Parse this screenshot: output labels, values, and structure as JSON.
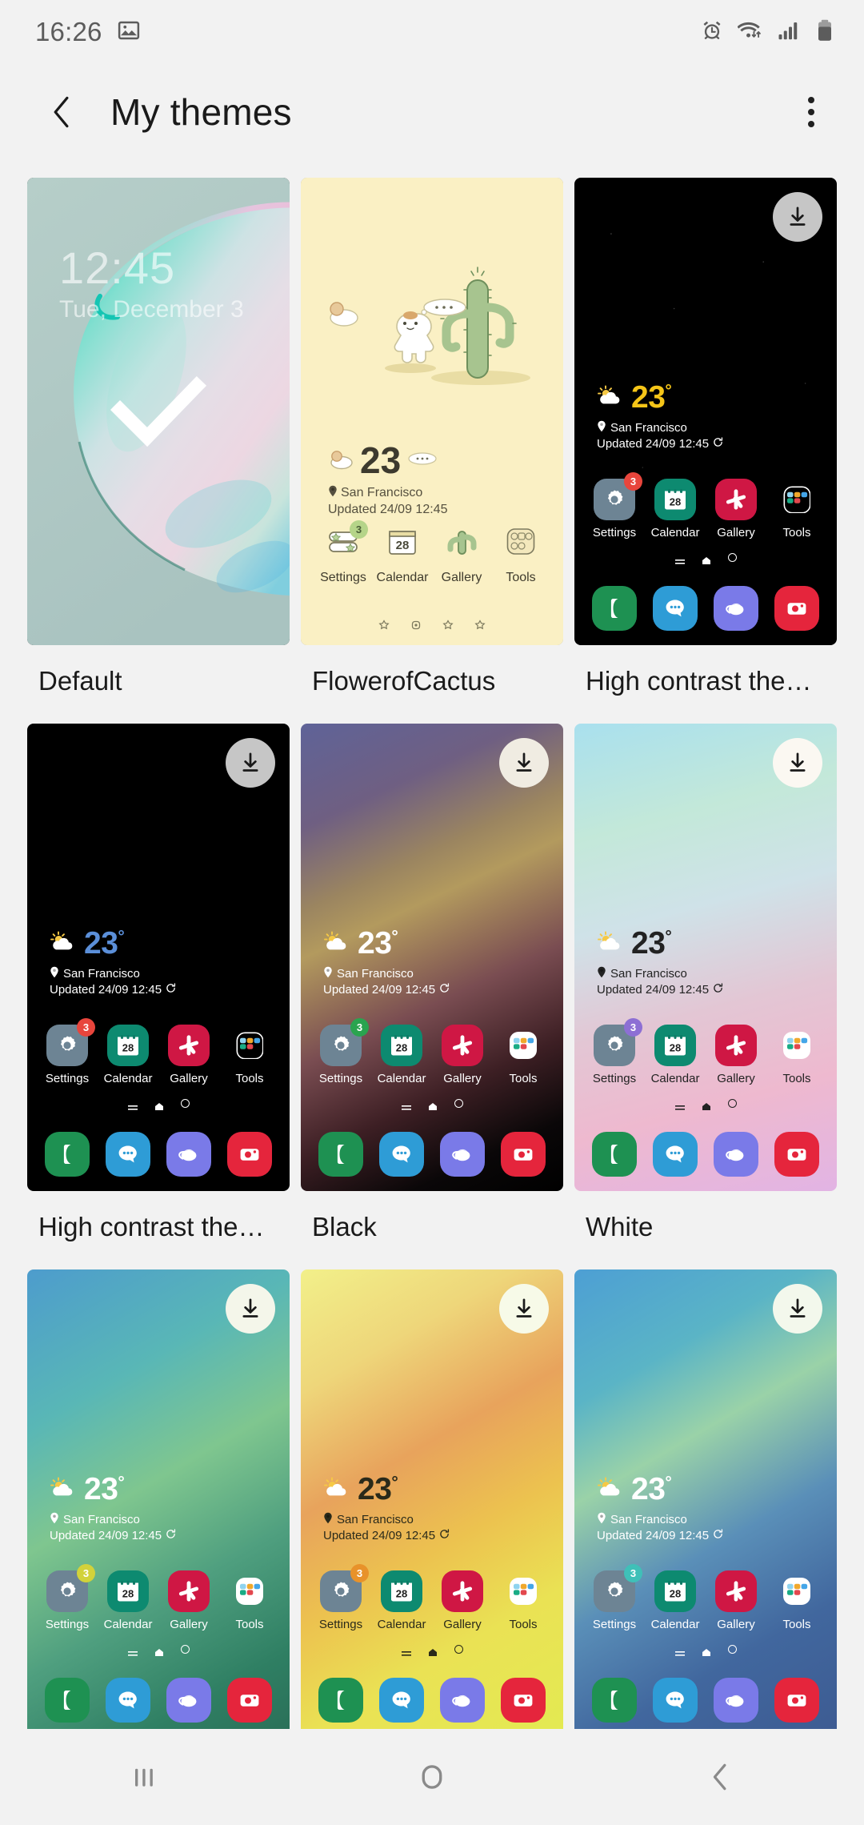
{
  "statusbar": {
    "time": "16:26",
    "icons": [
      "image-icon",
      "alarm-icon",
      "wifi-icon",
      "signal-icon",
      "battery-icon"
    ]
  },
  "appbar": {
    "back_icon": "back-chevron-icon",
    "title": "My themes",
    "menu_icon": "overflow-menu-icon"
  },
  "widget": {
    "temp": "23",
    "degree": "°",
    "location": "San Francisco",
    "updated": "Updated 24/09 12:45",
    "weather_icon": "sun-cloud-icon",
    "location_icon": "location-pin-icon",
    "refresh_icon": "refresh-icon"
  },
  "apps": [
    {
      "label": "Settings",
      "icon": "gear-icon",
      "badge": "3"
    },
    {
      "label": "Calendar",
      "icon": "calendar-icon",
      "day": "28"
    },
    {
      "label": "Gallery",
      "icon": "flower-icon"
    },
    {
      "label": "Tools",
      "icon": "folder-icon"
    }
  ],
  "dock": [
    {
      "icon": "phone-icon"
    },
    {
      "icon": "messages-icon"
    },
    {
      "icon": "internet-icon"
    },
    {
      "icon": "camera-icon"
    }
  ],
  "lockscreen": {
    "clock": "12:45",
    "date": "Tue, December 3"
  },
  "cactus": {
    "temp": "23",
    "location": "San Francisco",
    "updated": "Updated 24/09 12:45",
    "apps": [
      "Settings",
      "Calendar",
      "Gallery",
      "Tools"
    ],
    "badge": "3",
    "day": "28"
  },
  "themes": [
    {
      "label": "Default",
      "kind": "lockscreen",
      "selected": true,
      "downloadable": false
    },
    {
      "label": "FlowerofCactus",
      "kind": "cactus",
      "selected": false,
      "downloadable": false
    },
    {
      "label": "High contrast the…",
      "kind": "home",
      "selected": false,
      "downloadable": true,
      "bg": "black-stars",
      "temp_color": "#f5c518",
      "text_color": "#ffffff",
      "badge_color": "#e8453c",
      "dl_bg": "#c6c6c6",
      "dl_fg": "#1a1a1a",
      "folder_bg": "transparent",
      "folder_border": "#ffffff"
    },
    {
      "label": "High contrast the…",
      "kind": "home",
      "selected": false,
      "downloadable": true,
      "bg": "black-plain",
      "temp_color": "#5b8fd9",
      "text_color": "#ffffff",
      "badge_color": "#e8453c",
      "dl_bg": "#c6c6c6",
      "dl_fg": "#1a1a1a",
      "folder_bg": "transparent",
      "folder_border": "#ffffff"
    },
    {
      "label": "Black",
      "kind": "home",
      "selected": false,
      "downloadable": true,
      "bg": "black-gradient",
      "temp_color": "#ffffff",
      "text_color": "#ffffff",
      "badge_color": "#2aa44f",
      "dl_bg": "#f0ece2",
      "dl_fg": "#1a1a1a",
      "folder_bg": "#ffffff",
      "folder_border": "transparent"
    },
    {
      "label": "White",
      "kind": "home",
      "selected": false,
      "downloadable": true,
      "bg": "white-pastel",
      "temp_color": "#222222",
      "text_color": "#222222",
      "badge_color": "#8d6fd4",
      "dl_bg": "#fbf8f2",
      "dl_fg": "#1a1a1a",
      "folder_bg": "#ffffff",
      "folder_border": "transparent"
    },
    {
      "label": "",
      "kind": "home",
      "selected": false,
      "downloadable": true,
      "bg": "blue-green",
      "temp_color": "#ffffff",
      "text_color": "#ffffff",
      "badge_color": "#d2d23a",
      "dl_bg": "#f4f6ea",
      "dl_fg": "#1a1a1a",
      "folder_bg": "#ffffff",
      "folder_border": "transparent"
    },
    {
      "label": "",
      "kind": "home",
      "selected": false,
      "downloadable": true,
      "bg": "yellow-orange",
      "temp_color": "#2a2a1a",
      "text_color": "#2a2a1a",
      "badge_color": "#e8922a",
      "dl_bg": "#f7fae8",
      "dl_fg": "#1a1a1a",
      "folder_bg": "#ffffff",
      "folder_border": "transparent"
    },
    {
      "label": "",
      "kind": "home",
      "selected": false,
      "downloadable": true,
      "bg": "blue-deep",
      "temp_color": "#ffffff",
      "text_color": "#ffffff",
      "badge_color": "#3fc0b8",
      "dl_bg": "#f3f8ec",
      "dl_fg": "#1a1a1a",
      "folder_bg": "#ffffff",
      "folder_border": "transparent"
    }
  ],
  "navbar": {
    "recents_icon": "recents-icon",
    "home_icon": "home-icon",
    "back_icon": "back-icon"
  },
  "colors": {
    "page_bg": "#f2f2f2",
    "text_primary": "#1a1a1a",
    "status_grey": "#5c5c5c",
    "check_white": "#ffffff"
  }
}
